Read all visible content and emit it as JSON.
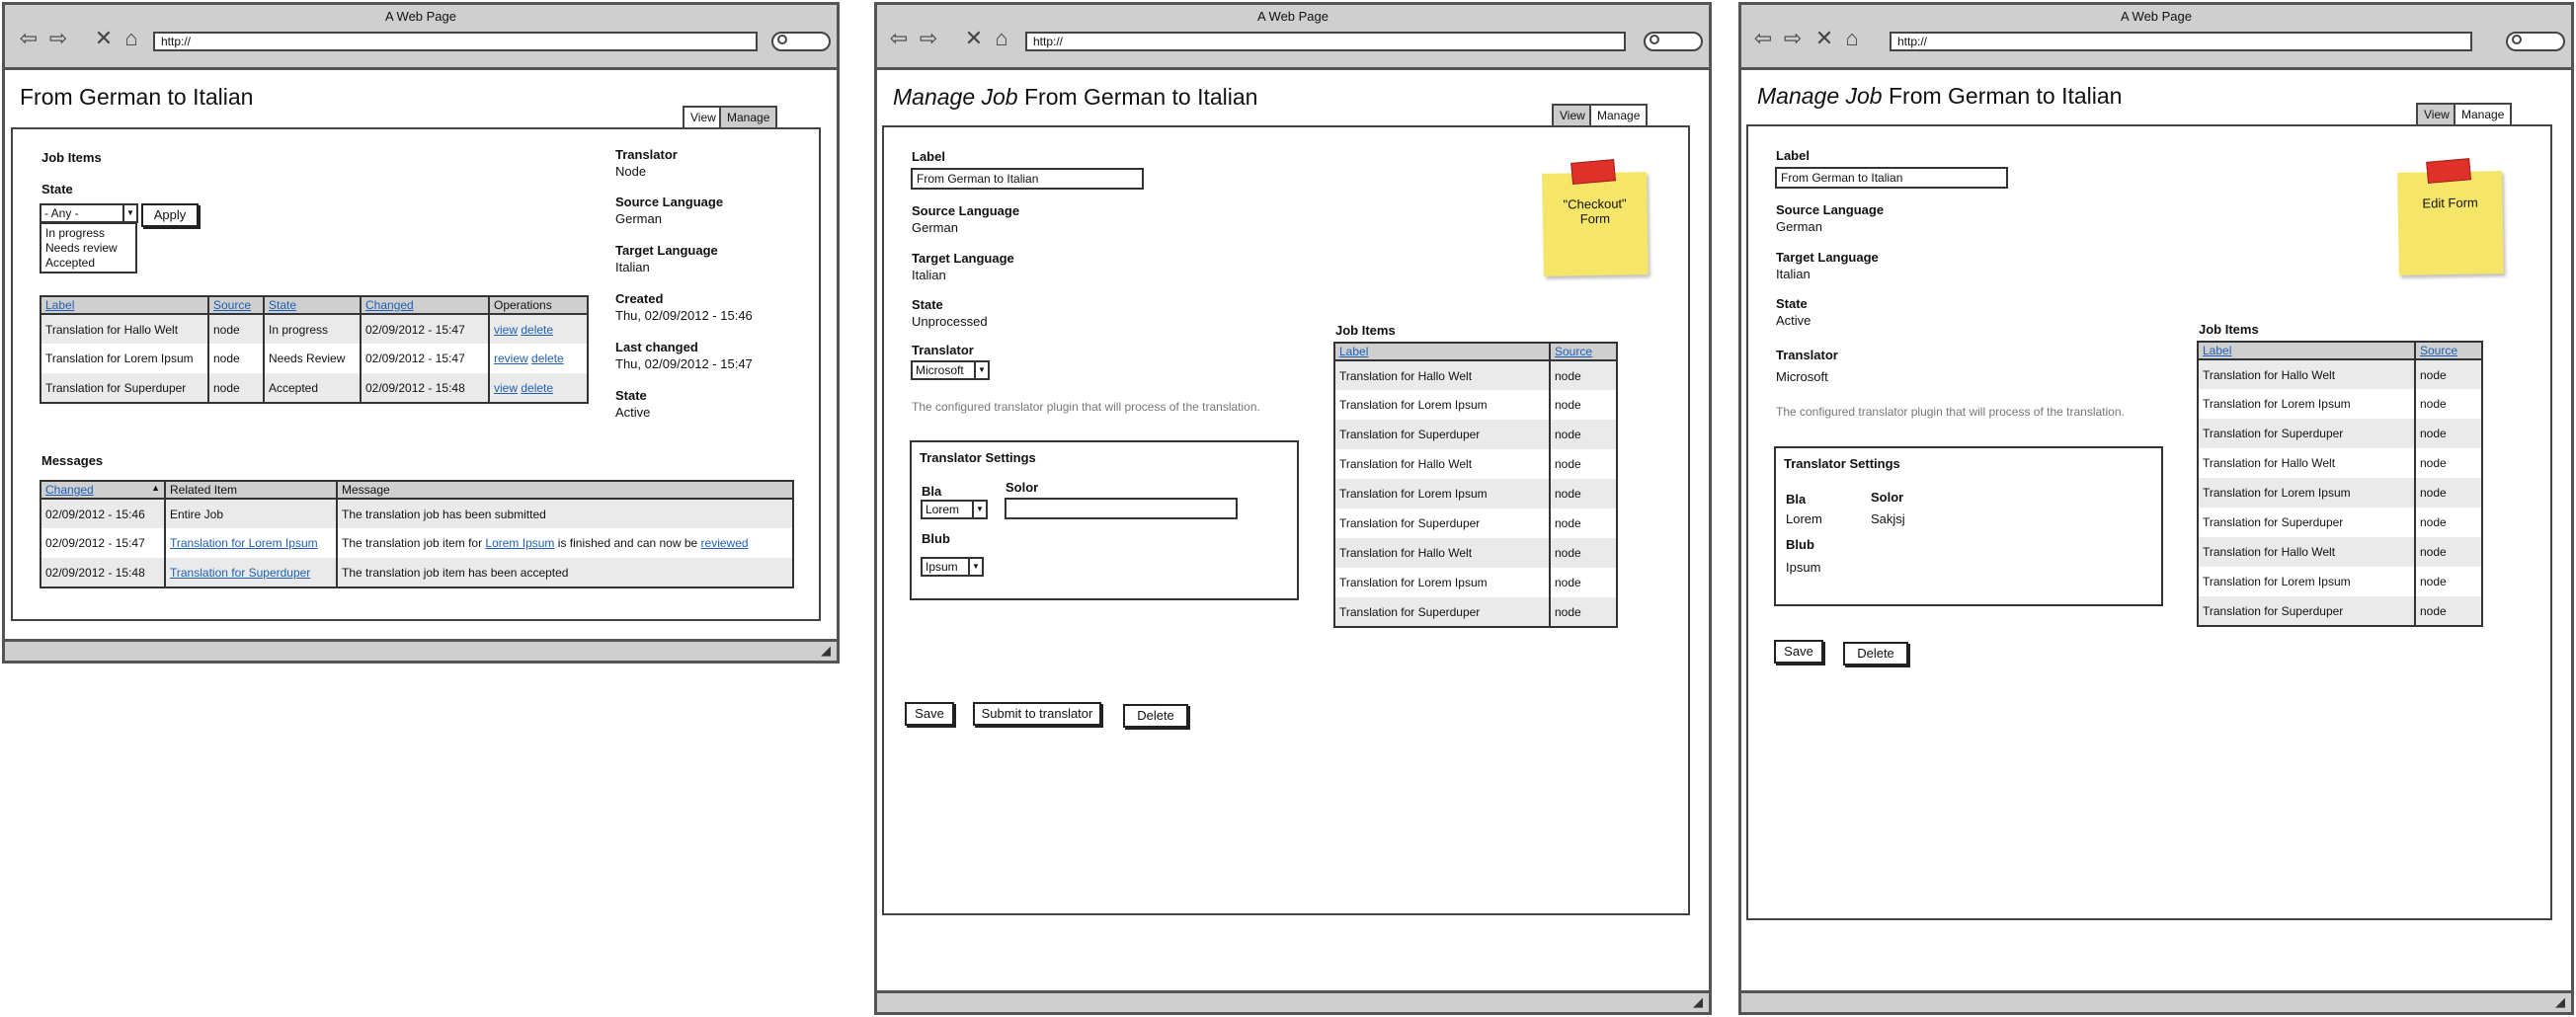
{
  "browser": {
    "title": "A Web Page",
    "url": "http://"
  },
  "view": {
    "heading": "From German to Italian",
    "tabs": {
      "view": "View",
      "manage": "Manage"
    },
    "job_items": {
      "title": "Job Items",
      "state_label": "State",
      "state_select": "- Any -",
      "state_options": [
        "In progress",
        "Needs review",
        "Accepted"
      ],
      "apply": "Apply",
      "columns": [
        "Label",
        "Source",
        "State",
        "Changed",
        "Operations"
      ],
      "rows": [
        {
          "label": "Translation for Hallo Welt",
          "source": "node",
          "state": "In progress",
          "changed": "02/09/2012 - 15:47",
          "op1": "view",
          "op2": "delete"
        },
        {
          "label": "Translation for Lorem Ipsum",
          "source": "node",
          "state": "Needs Review",
          "changed": "02/09/2012 - 15:47",
          "op1": "review",
          "op2": "delete"
        },
        {
          "label": "Translation for Superduper",
          "source": "node",
          "state": "Accepted",
          "changed": "02/09/2012 - 15:48",
          "op1": "view",
          "op2": "delete"
        }
      ]
    },
    "info": {
      "translator_label": "Translator",
      "translator": "Node",
      "source_label": "Source Language",
      "source": "German",
      "target_label": "Target Language",
      "target": "Italian",
      "created_label": "Created",
      "created": "Thu, 02/09/2012 - 15:46",
      "changed_label": "Last changed",
      "changed": "Thu, 02/09/2012 - 15:47",
      "state_label": "State",
      "state": "Active"
    },
    "messages": {
      "title": "Messages",
      "columns": [
        "Changed",
        "Related Item",
        "Message"
      ],
      "sort_indicator": "▲",
      "rows": [
        {
          "changed": "02/09/2012 - 15:46",
          "item": "Entire Job",
          "message": "The translation job has been submitted"
        },
        {
          "changed": "02/09/2012 - 15:47",
          "item": "Translation for Lorem Ipsum",
          "msg_a": "The translation job item for ",
          "msg_link": "Lorem Ipsum",
          "msg_b": " is finished and can now be ",
          "msg_link2": "reviewed"
        },
        {
          "changed": "02/09/2012 - 15:48",
          "item": "Translation for Superduper",
          "message": "The translation job item has been accepted"
        }
      ]
    }
  },
  "manage": {
    "heading_em": "Manage Job",
    "heading_rest": " From German to Italian",
    "tabs": {
      "view": "View",
      "manage": "Manage"
    },
    "label_label": "Label",
    "label_value": "From German to Italian",
    "source_label": "Source Language",
    "source": "German",
    "target_label": "Target Language",
    "target": "Italian",
    "state_label": "State",
    "translator_label": "Translator",
    "translator_hint": "The configured translator plugin that will process of the translation.",
    "settings_title": "Translator Settings",
    "bla_label": "Bla",
    "solor_label": "Solor",
    "blub_label": "Blub",
    "job_items_title": "Job Items",
    "job_columns": [
      "Label",
      "Source"
    ],
    "job_rows": [
      {
        "label": "Translation for Hallo Welt",
        "source": "node"
      },
      {
        "label": "Translation for Lorem Ipsum",
        "source": "node"
      },
      {
        "label": "Translation for Superduper",
        "source": "node"
      },
      {
        "label": "Translation for Hallo Welt",
        "source": "node"
      },
      {
        "label": "Translation for Lorem Ipsum",
        "source": "node"
      },
      {
        "label": "Translation for Superduper",
        "source": "node"
      },
      {
        "label": "Translation for Hallo Welt",
        "source": "node"
      },
      {
        "label": "Translation for Lorem Ipsum",
        "source": "node"
      },
      {
        "label": "Translation for Superduper",
        "source": "node"
      }
    ],
    "save": "Save",
    "delete": "Delete"
  },
  "checkout": {
    "state": "Unprocessed",
    "translator_select": "Microsoft",
    "bla_select": "Lorem",
    "blub_select": "Ipsum",
    "solor_value": "",
    "submit": "Submit to translator",
    "sticky": "\"Checkout\" Form"
  },
  "edit": {
    "state": "Active",
    "translator_value": "Microsoft",
    "bla_value": "Lorem",
    "solor_value": "Sakjsj",
    "blub_value": "Ipsum",
    "sticky": "Edit Form"
  }
}
